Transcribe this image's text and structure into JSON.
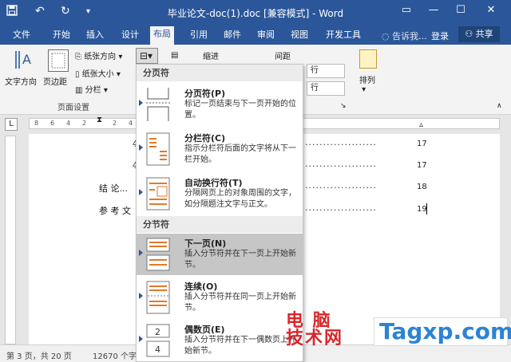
{
  "titlebar": {
    "title": "毕业论文-doc(1).doc [兼容模式] - Word",
    "save_icon": "save-icon",
    "undo_glyph": "↶",
    "redo_glyph": "↻",
    "min_glyph": "—",
    "max_glyph": "☐",
    "close_glyph": "✕",
    "ribbon_toggle_glyph": "▭"
  },
  "tabs": [
    "文件",
    "开始",
    "插入",
    "设计",
    "布局",
    "引用",
    "邮件",
    "审阅",
    "视图",
    "开发工具"
  ],
  "active_tab": "布局",
  "tellme": "告诉我...",
  "login": "登录",
  "share": "共享",
  "ribbon": {
    "text_direction": "文字方向",
    "margins": "页边距",
    "orientation": "纸张方向",
    "size": "纸张大小",
    "columns": "分栏",
    "page_setup": "页面设置",
    "indent": "缩进",
    "spacing": "间距",
    "spin1": "行",
    "spin2": "行",
    "arrange": "排列"
  },
  "ruler_numbers": [
    "8",
    "6",
    "4",
    "2",
    "2",
    "4"
  ],
  "corner": "L",
  "document": {
    "lines": [
      {
        "text": "4",
        "page": "17"
      },
      {
        "text": "4",
        "page": "17"
      },
      {
        "text": "结  论...",
        "page": "18"
      },
      {
        "text": "参 考 文",
        "page": "19"
      }
    ]
  },
  "status": {
    "page": "第 3 页，共 20 页",
    "words": "12670 个字"
  },
  "dropdown": {
    "page_breaks_header": "分页符",
    "section_breaks_header": "分节符",
    "items": [
      {
        "title": "分页符(P)",
        "desc": "标记一页结束与下一页开始的位置。"
      },
      {
        "title": "分栏符(C)",
        "desc": "指示分栏符后面的文字将从下一栏开始。"
      },
      {
        "title": "自动换行符(T)",
        "desc": "分隔网页上的对象周围的文字，如分隔题注文字与正文。"
      },
      {
        "title": "下一页(N)",
        "desc": "插入分节符并在下一页上开始新节。"
      },
      {
        "title": "连续(O)",
        "desc": "插入分节符并在同一页上开始新节。"
      },
      {
        "title": "偶数页(E)",
        "desc": "插入分节符并在下一偶数页上开始新节。"
      }
    ]
  },
  "watermark": {
    "cn": "电 脑\n技术网",
    "en": "Tagxp.com"
  }
}
